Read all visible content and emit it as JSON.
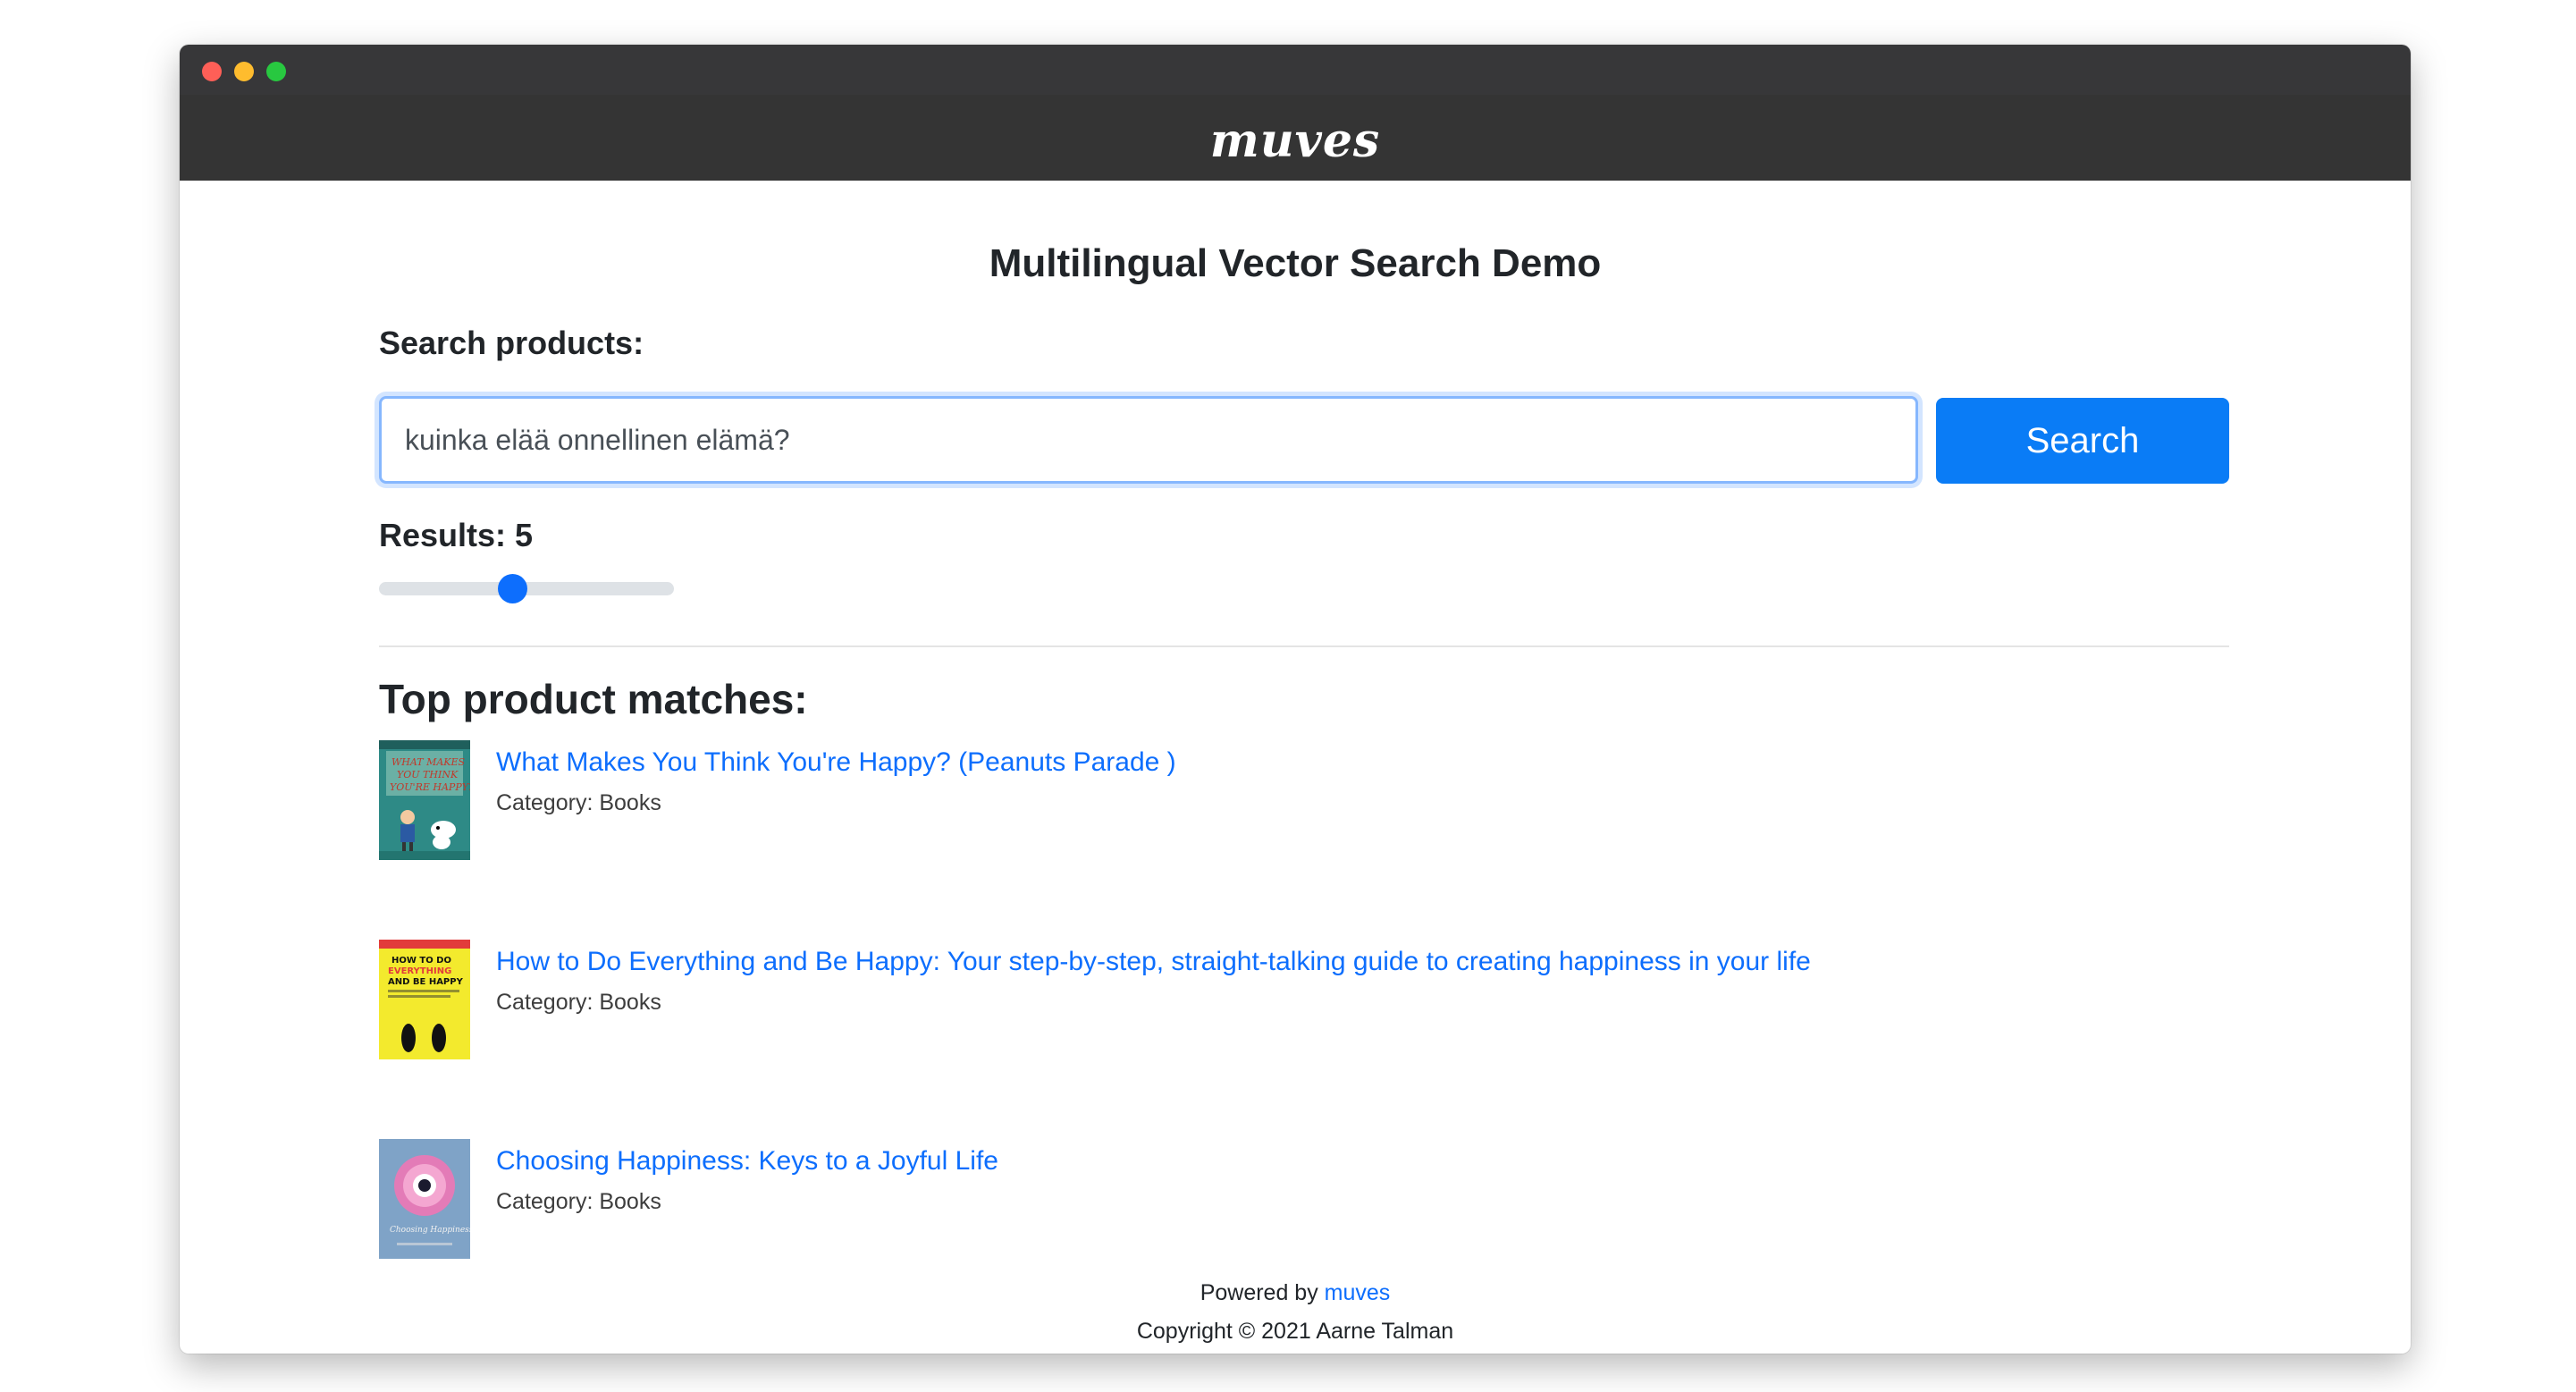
{
  "window": {
    "brand": "muves"
  },
  "page": {
    "title": "Multilingual Vector Search Demo"
  },
  "search": {
    "label": "Search products:",
    "value": "kuinka elää onnellinen elämä?",
    "button_label": "Search"
  },
  "results": {
    "label": "Results: 5",
    "slider_fraction": 0.45
  },
  "matches": {
    "heading": "Top product matches:",
    "items": [
      {
        "title": "What Makes You Think You're Happy? (Peanuts Parade )",
        "category": "Category: Books",
        "thumb": "peanuts-cover"
      },
      {
        "title": "How to Do Everything and Be Happy: Your step-by-step, straight-talking guide to creating happiness in your life",
        "category": "Category: Books",
        "thumb": "smiley-cover"
      },
      {
        "title": "Choosing Happiness: Keys to a Joyful Life",
        "category": "Category: Books",
        "thumb": "flower-cover"
      }
    ]
  },
  "footer": {
    "powered_prefix": "Powered by",
    "powered_link": "muves",
    "copyright": "Copyright © 2021 Aarne Talman"
  },
  "colors": {
    "accent": "#0d6efd",
    "button": "#0a7cf6",
    "navbar": "#343434"
  }
}
